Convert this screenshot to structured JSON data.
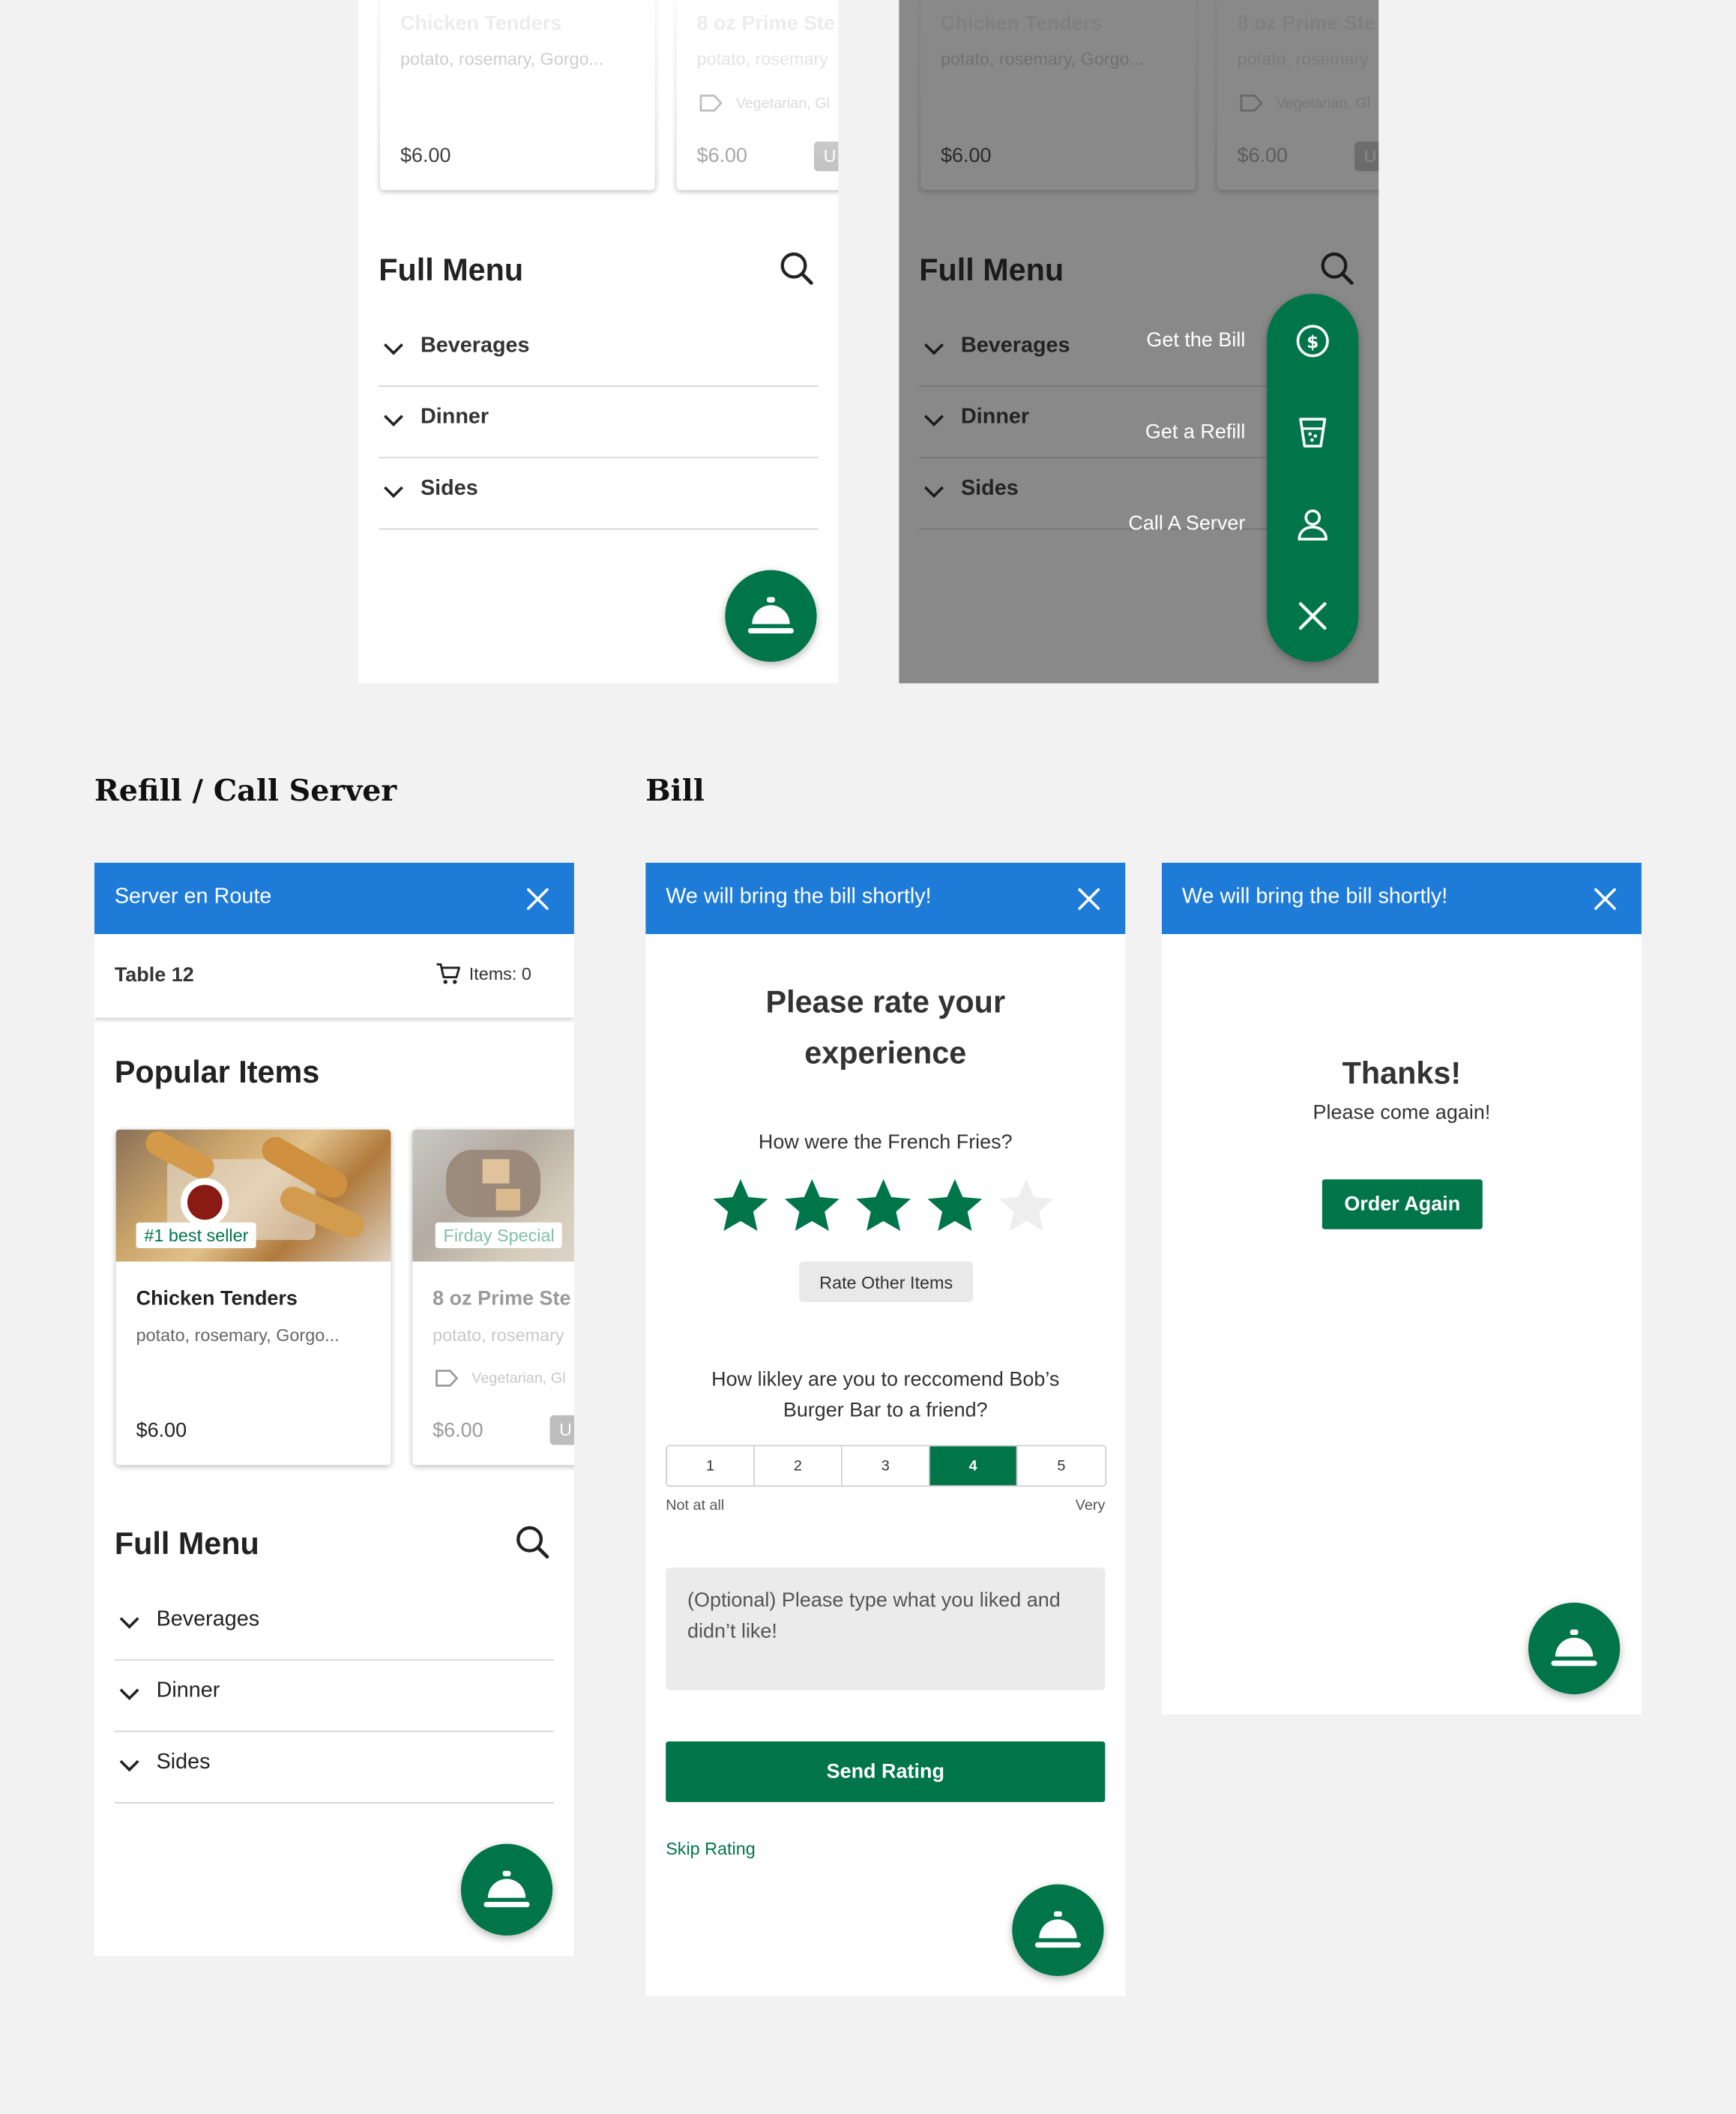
{
  "colors": {
    "brand_green": "#00754a",
    "banner_blue": "#1e7bd8",
    "overlay_gray": "#8a8a8a",
    "star_empty": "#eeeeee"
  },
  "icons": {
    "fab": "service-bell-icon",
    "search": "search-icon",
    "chevron": "chevron-down-icon",
    "close": "close-icon",
    "cart": "cart-icon",
    "tag": "tag-icon",
    "bill": "dollar-circle-icon",
    "refill": "drink-cup-icon",
    "server": "person-icon",
    "star": "star-icon"
  },
  "shared": {
    "card1": {
      "name": "Chicken Tenders",
      "desc": "potato, rosemary, Gorgo...",
      "price": "$6.00"
    },
    "card2": {
      "name": "8 oz Prime Ste",
      "desc": "potato, rosemary",
      "tags": "Vegetarian, Gl",
      "price": "$6.00",
      "btn": "U"
    },
    "full_menu": {
      "title": "Full Menu",
      "items": [
        "Beverages",
        "Dinner",
        "Sides"
      ]
    }
  },
  "fab_menu": {
    "bill": "Get the Bill",
    "refill": "Get a Refill",
    "server": "Call A Server"
  },
  "sections": {
    "refill": "Refill / Call Server",
    "bill": "Bill"
  },
  "refill_screen": {
    "banner": "Server en Route",
    "table": "Table 12",
    "items": "Items: 0",
    "popular_title": "Popular Items",
    "badge1": "#1 best seller",
    "badge2": "Firday Special"
  },
  "rating_screen": {
    "banner": "We will bring the bill shortly!",
    "heading": "Please rate your experience",
    "question": "How were the French Fries?",
    "stars": 4,
    "stars_max": 5,
    "rate_other": "Rate Other Items",
    "nps_question": "How likley are you to reccomend Bob’s Burger Bar to a friend?",
    "nps_options": [
      "1",
      "2",
      "3",
      "4",
      "5"
    ],
    "nps_selected": "4",
    "nps_low": "Not at all",
    "nps_high": "Very",
    "feedback_placeholder": "(Optional) Please type what you liked and didn’t like!",
    "send": "Send Rating",
    "skip": "Skip Rating"
  },
  "thanks_screen": {
    "banner": "We will bring the bill shortly!",
    "title": "Thanks!",
    "subtitle": "Please come again!",
    "order_again": "Order Again"
  }
}
